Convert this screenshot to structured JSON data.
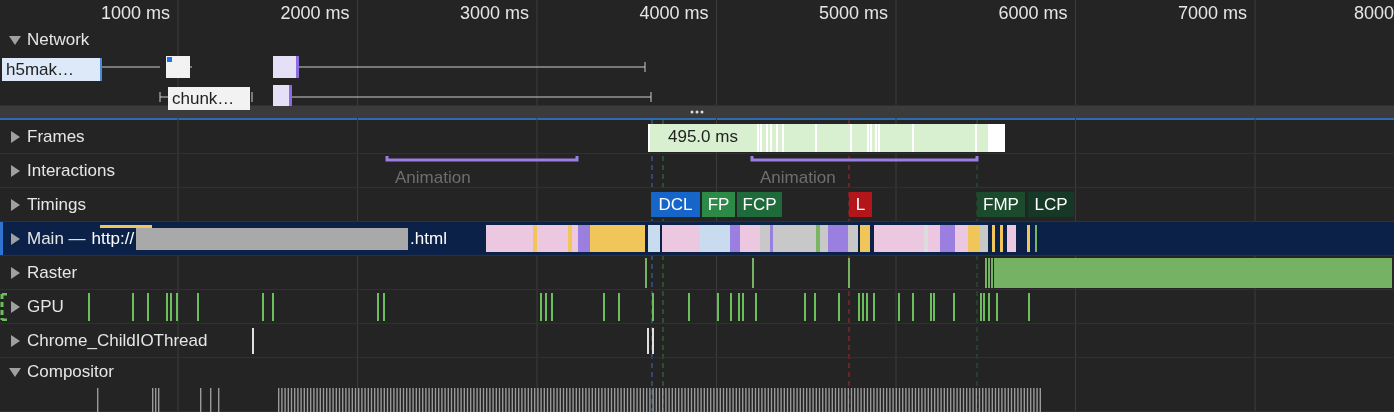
{
  "ruler": {
    "ticks": [
      "1000 ms",
      "2000 ms",
      "3000 ms",
      "4000 ms",
      "5000 ms",
      "6000 ms",
      "7000 ms",
      "8000"
    ]
  },
  "tracks": [
    {
      "kind": "network",
      "name": "Network",
      "expanded": true,
      "selected": false,
      "requests": [
        {
          "label": "h5mak…"
        },
        {
          "label": "chunk…"
        }
      ]
    },
    {
      "kind": "frames",
      "name": "Frames",
      "expanded": false,
      "selected": false,
      "frame_label": "495.0 ms"
    },
    {
      "kind": "interactions",
      "name": "Interactions",
      "expanded": false,
      "selected": false,
      "animations": [
        "Animation",
        "Animation"
      ]
    },
    {
      "kind": "timings",
      "name": "Timings",
      "expanded": false,
      "selected": false,
      "markers": [
        {
          "label": "DCL",
          "color": "#1566c8"
        },
        {
          "label": "FP",
          "color": "#2a8a46"
        },
        {
          "label": "FCP",
          "color": "#1f6a3a"
        },
        {
          "label": "L",
          "color": "#b3161a"
        },
        {
          "label": "FMP",
          "color": "#1b4b2d"
        },
        {
          "label": "LCP",
          "color": "#163826"
        }
      ]
    },
    {
      "kind": "main",
      "name": "Main — ",
      "url_start": "http://",
      "url_end": ".html",
      "expanded": false,
      "selected": true
    },
    {
      "kind": "raster",
      "name": "Raster",
      "expanded": false,
      "selected": false
    },
    {
      "kind": "gpu",
      "name": "GPU",
      "expanded": false,
      "selected": false
    },
    {
      "kind": "io",
      "name": "Chrome_ChildIOThread",
      "expanded": false,
      "selected": false
    },
    {
      "kind": "compositor",
      "name": "Compositor",
      "expanded": true,
      "selected": false
    }
  ]
}
